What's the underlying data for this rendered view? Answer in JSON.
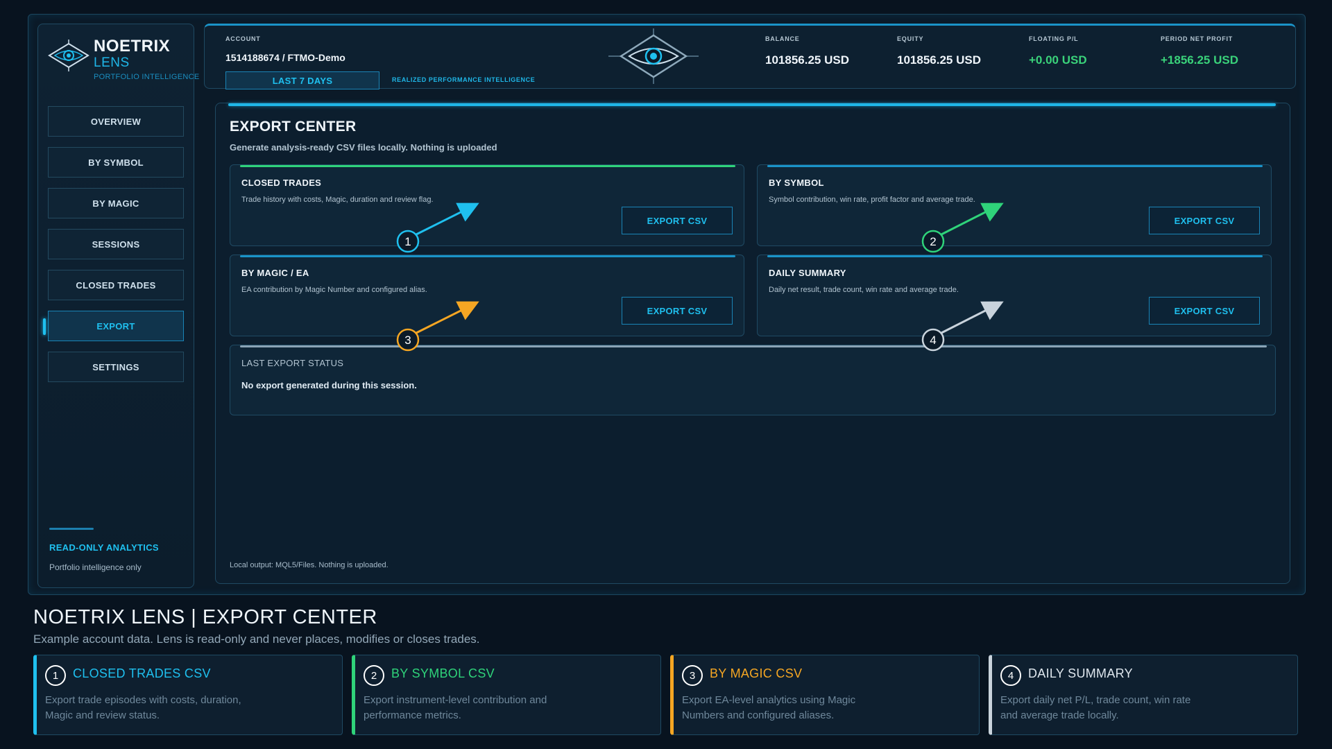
{
  "brand": {
    "title": "NOETRIX",
    "subtitle": "LENS",
    "tagline": "PORTFOLIO INTELLIGENCE"
  },
  "sidebar": {
    "items": [
      {
        "label": "OVERVIEW"
      },
      {
        "label": "BY SYMBOL"
      },
      {
        "label": "BY MAGIC"
      },
      {
        "label": "SESSIONS"
      },
      {
        "label": "CLOSED TRADES"
      },
      {
        "label": "EXPORT"
      },
      {
        "label": "SETTINGS"
      }
    ],
    "active_item": "EXPORT",
    "footer_title": "READ-ONLY ANALYTICS",
    "footer_sub": "Portfolio intelligence only"
  },
  "header": {
    "account_label": "ACCOUNT",
    "account_value": "1514188674 / FTMO-Demo",
    "range_button": "LAST 7 DAYS",
    "intel_label": "REALIZED PERFORMANCE INTELLIGENCE",
    "balance_label": "BALANCE",
    "balance_value": "101856.25 USD",
    "equity_label": "EQUITY",
    "equity_value": "101856.25 USD",
    "floating_label": "FLOATING P/L",
    "floating_value": "+0.00 USD",
    "period_label": "PERIOD NET PROFIT",
    "period_value": "+1856.25 USD"
  },
  "main": {
    "title": "EXPORT CENTER",
    "subtitle": "Generate analysis-ready CSV files locally. Nothing is uploaded",
    "cards": [
      {
        "title": "CLOSED TRADES",
        "desc": "Trade history with costs, Magic, duration and review flag.",
        "button": "EXPORT CSV"
      },
      {
        "title": "BY SYMBOL",
        "desc": "Symbol contribution, win rate, profit factor and average trade.",
        "button": "EXPORT CSV"
      },
      {
        "title": "BY MAGIC / EA",
        "desc": "EA contribution by Magic Number and configured alias.",
        "button": "EXPORT CSV"
      },
      {
        "title": "DAILY SUMMARY",
        "desc": "Daily net result, trade count, win rate and average trade.",
        "button": "EXPORT CSV"
      }
    ],
    "status_title": "LAST EXPORT STATUS",
    "status_text": "No export generated during this session.",
    "footer": "Local output: MQL5/Files. Nothing is uploaded."
  },
  "annotations": {
    "markers": [
      "1",
      "2",
      "3",
      "4"
    ],
    "colors": [
      "#1fc0ef",
      "#2fd37a",
      "#f5a623",
      "#c9d3dc"
    ]
  },
  "bottom": {
    "title": "NOETRIX LENS | EXPORT CENTER",
    "subtitle": "Example account data. Lens is read-only and never places, modifies or closes trades.",
    "legend": [
      {
        "num": "1",
        "title": "CLOSED TRADES CSV",
        "desc": "Export trade episodes with costs, duration, Magic and review status.",
        "color": "#1fc0ef"
      },
      {
        "num": "2",
        "title": "BY SYMBOL CSV",
        "desc": "Export instrument-level contribution and performance metrics.",
        "color": "#2fd37a"
      },
      {
        "num": "3",
        "title": "BY MAGIC CSV",
        "desc": "Export EA-level analytics using Magic Numbers and configured aliases.",
        "color": "#f5a623"
      },
      {
        "num": "4",
        "title": "DAILY SUMMARY",
        "desc": "Export daily net P/L, trade count, win rate and average trade locally.",
        "color": "#c9d3dc"
      }
    ]
  }
}
